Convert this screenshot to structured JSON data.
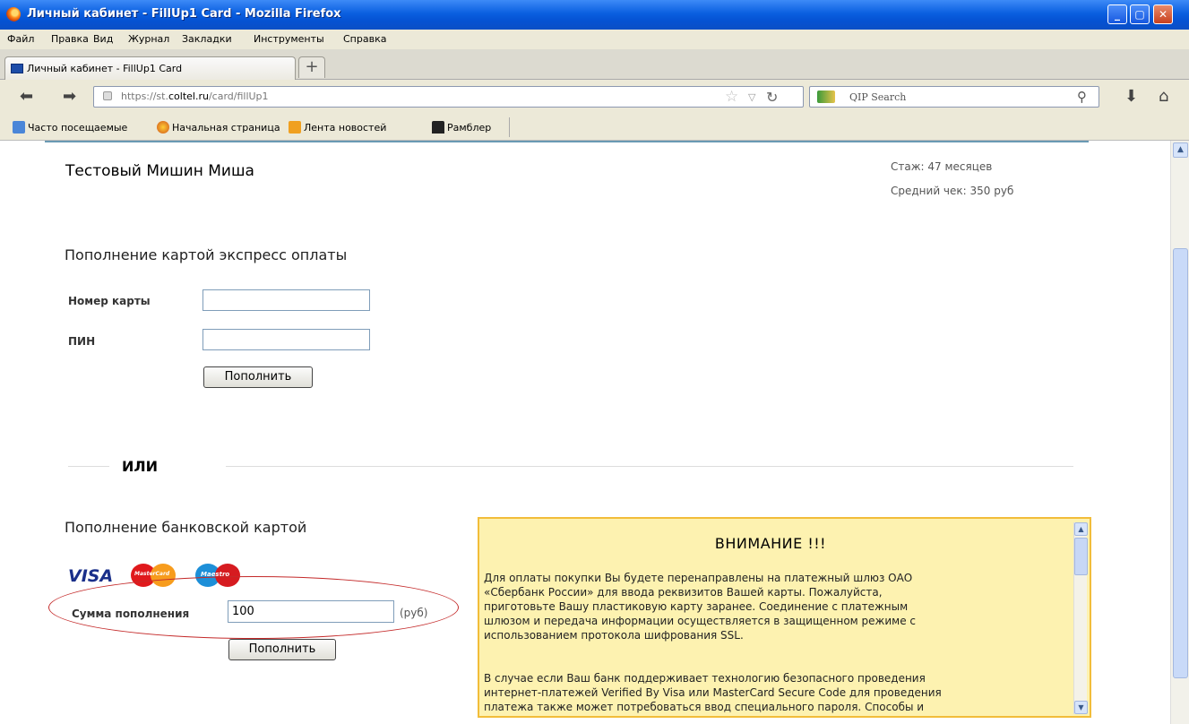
{
  "window": {
    "title": "Личный кабинет - FillUp1 Card - Mozilla Firefox"
  },
  "menu": {
    "items": [
      "Файл",
      "Правка",
      "Вид",
      "Журнал",
      "Закладки",
      "Инструменты",
      "Справка"
    ]
  },
  "tabs": {
    "active_label": "Личный кабинет - FillUp1 Card",
    "new_tab": "+"
  },
  "nav": {
    "url_prefix": "https://st.",
    "url_domain": "coltel.ru",
    "url_path": "/card/fillUp1",
    "search_placeholder": "QIP Search"
  },
  "bookmarks": [
    "Часто посещаемые",
    "Начальная страница",
    "Лента новостей",
    "Рамблер"
  ],
  "user": {
    "name": "Тестовый Мишин Миша",
    "stazh": "Стаж: 47 месяцев",
    "avg_check": "Средний чек: 350 руб"
  },
  "express": {
    "title": "Пополнение картой экспресс оплаты",
    "card_label": "Номер карты",
    "card_value": "",
    "pin_label": "ПИН",
    "pin_value": "",
    "submit": "Пополнить"
  },
  "or_label": "ИЛИ",
  "bank": {
    "title": "Пополнение банковской картой",
    "logos": {
      "visa": "VISA",
      "mastercard": "MasterCard",
      "maestro": "Maestro"
    },
    "sum_label": "Сумма пополнения",
    "sum_value": "100",
    "currency": "(руб)",
    "submit": "Пополнить"
  },
  "warning": {
    "title": "ВНИМАНИЕ !!!",
    "p1_lines": [
      "Для оплаты покупки Вы будете перенаправлены на платежный шлюз ОАО",
      "«Сбербанк России» для ввода реквизитов Вашей карты. Пожалуйста,",
      "приготовьте Вашу пластиковую карту заранее. Соединение с платежным",
      "шлюзом и передача информации осуществляется в защищенном режиме с",
      "использованием протокола шифрования SSL."
    ],
    "p2_lines": [
      "В случае если Ваш банк поддерживает технологию безопасного проведения",
      "интернет-платежей Verified By Visa или MasterCard Secure Code для проведения",
      "платежа также может потребоваться ввод специального пароля. Способы и"
    ]
  },
  "colors": {
    "titlebar": "#0a5fe0",
    "warning_bg": "#fdf2b0",
    "warning_border": "#f2bd3a",
    "ellipse": "#c42a2a"
  }
}
